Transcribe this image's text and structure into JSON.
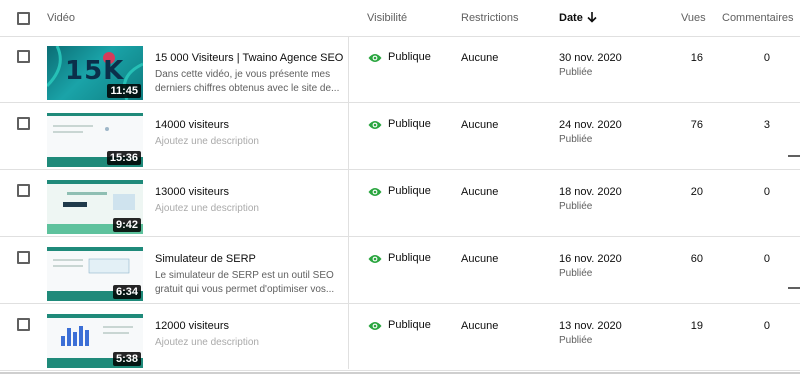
{
  "header": {
    "video": "Vidéo",
    "visibility": "Visibilité",
    "restrictions": "Restrictions",
    "date": "Date",
    "views": "Vues",
    "comments": "Commentaires"
  },
  "rows": [
    {
      "title": "15 000 Visiteurs | Twaino Agence SEO",
      "description": "Dans cette vidéo, je vous présente mes derniers chiffres obtenus avec le site de...",
      "thumb_text": "15K",
      "duration": "11:45",
      "visibility": "Publique",
      "restriction": "Aucune",
      "date": "30 nov. 2020",
      "status": "Publiée",
      "views": "16",
      "comments": "0"
    },
    {
      "title": "14000 visiteurs",
      "description": "Ajoutez une description",
      "duration": "15:36",
      "visibility": "Publique",
      "restriction": "Aucune",
      "date": "24 nov. 2020",
      "status": "Publiée",
      "views": "76",
      "comments": "3"
    },
    {
      "title": "13000 visiteurs",
      "description": "Ajoutez une description",
      "duration": "9:42",
      "visibility": "Publique",
      "restriction": "Aucune",
      "date": "18 nov. 2020",
      "status": "Publiée",
      "views": "20",
      "comments": "0"
    },
    {
      "title": "Simulateur de SERP",
      "description": "Le simulateur de SERP est un outil SEO gratuit qui vous permet d'optimiser vos...",
      "duration": "6:34",
      "visibility": "Publique",
      "restriction": "Aucune",
      "date": "16 nov. 2020",
      "status": "Publiée",
      "views": "60",
      "comments": "0"
    },
    {
      "title": "12000 visiteurs",
      "description": "Ajoutez une description",
      "duration": "5:38",
      "visibility": "Publique",
      "restriction": "Aucune",
      "date": "13 nov. 2020",
      "status": "Publiée",
      "views": "19",
      "comments": "0"
    }
  ],
  "colors": {
    "visibility_icon": "#2ba640",
    "thumb_brand": "#1f8a7a"
  }
}
